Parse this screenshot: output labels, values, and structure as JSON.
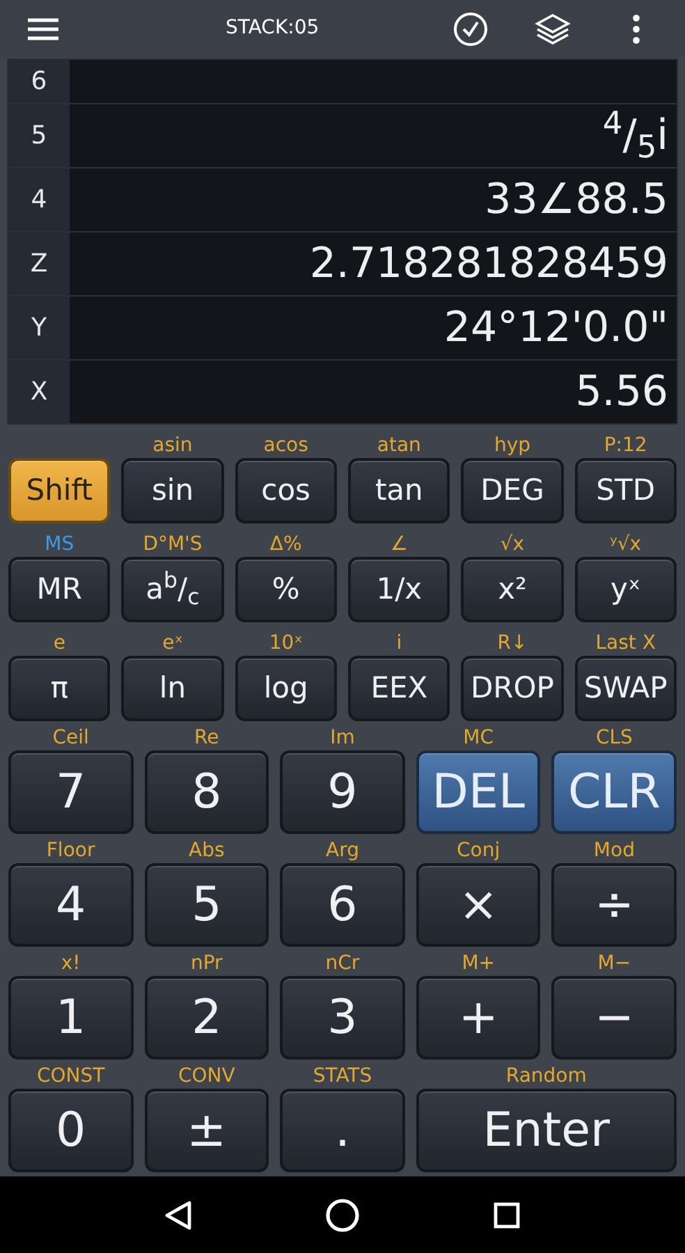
{
  "header": {
    "title": "STACK:05"
  },
  "stack": [
    {
      "label": "6"
    },
    {
      "label": "5",
      "value": "$^{4}$/$_{5}$i"
    },
    {
      "label": "4",
      "value": "33∠88.5"
    },
    {
      "label": "Z",
      "value": "2.718281828459"
    },
    {
      "label": "Y",
      "value": "24°12'0.0\""
    },
    {
      "label": "X",
      "value": "5.56"
    }
  ],
  "function_rows": [
    [
      {
        "label": "Shift",
        "kind": "shift"
      },
      {
        "label": "sin",
        "alt": {
          "text": "asin",
          "color": "#e3a82c"
        },
        "kind": "plain"
      },
      {
        "label": "cos",
        "alt": {
          "text": "acos",
          "color": "#e3a82c"
        },
        "kind": "plain"
      },
      {
        "label": "tan",
        "alt": {
          "text": "atan",
          "color": "#e3a82c"
        },
        "kind": "plain"
      },
      {
        "label": "DEG",
        "alt": {
          "text": "hyp",
          "color": "#e3a82c"
        },
        "kind": "plain"
      },
      {
        "label": "STD",
        "alt": {
          "text": "P:12",
          "color": "#e3a82c"
        },
        "kind": "plain"
      }
    ],
    [
      {
        "label": "MR",
        "alt": {
          "text": "MS",
          "color": "#3d9be3"
        },
        "kind": "plain"
      },
      {
        "label": "a$^{b}$/$_{c}$",
        "alt": {
          "text": "D°M'S",
          "color": "#e3a82c"
        },
        "kind": "plain"
      },
      {
        "label": "%",
        "alt": {
          "text": "Δ%",
          "color": "#e3a82c"
        },
        "kind": "plain"
      },
      {
        "label": "1/x",
        "alt": {
          "text": "∠",
          "color": "#e3a82c"
        },
        "kind": "plain"
      },
      {
        "label": "x²",
        "alt": {
          "text": "√x",
          "color": "#e3a82c"
        },
        "kind": "plain"
      },
      {
        "label": "yˣ",
        "alt": {
          "text": "ʸ√x",
          "color": "#e3a82c"
        },
        "kind": "plain"
      }
    ],
    [
      {
        "label": "π",
        "alt": {
          "text": "e",
          "color": "#e3a82c"
        },
        "kind": "plain"
      },
      {
        "label": "ln",
        "alt": {
          "text": "eˣ",
          "color": "#e3a82c"
        },
        "kind": "plain"
      },
      {
        "label": "log",
        "alt": {
          "text": "10ˣ",
          "color": "#e3a82c"
        },
        "kind": "plain"
      },
      {
        "label": "EEX",
        "alt": {
          "text": "i",
          "color": "#e3a82c"
        },
        "kind": "plain"
      },
      {
        "label": "DROP",
        "alt": {
          "text": "R↓",
          "color": "#e3a82c"
        },
        "kind": "plain"
      },
      {
        "label": "SWAP",
        "alt": {
          "text": "Last X",
          "color": "#e3a82c"
        },
        "kind": "plain"
      }
    ]
  ],
  "number_rows": [
    [
      {
        "label": "7",
        "alt": {
          "text": "Ceil",
          "color": "#e3a82c"
        },
        "kind": "plain"
      },
      {
        "label": "8",
        "alt": {
          "text": "Re",
          "color": "#e3a82c"
        },
        "kind": "plain"
      },
      {
        "label": "9",
        "alt": {
          "text": "Im",
          "color": "#e3a82c"
        },
        "kind": "plain"
      },
      {
        "label": "DEL",
        "alt": {
          "text": "MC",
          "color": "#e3a82c"
        },
        "kind": "accent"
      },
      {
        "label": "CLR",
        "alt": {
          "text": "CLS",
          "color": "#e3a82c"
        },
        "kind": "accent"
      }
    ],
    [
      {
        "label": "4",
        "alt": {
          "text": "Floor",
          "color": "#e3a82c"
        },
        "kind": "plain"
      },
      {
        "label": "5",
        "alt": {
          "text": "Abs",
          "color": "#e3a82c"
        },
        "kind": "plain"
      },
      {
        "label": "6",
        "alt": {
          "text": "Arg",
          "color": "#e3a82c"
        },
        "kind": "plain"
      },
      {
        "label": "×",
        "alt": {
          "text": "Conj",
          "color": "#e3a82c"
        },
        "kind": "plain"
      },
      {
        "label": "÷",
        "alt": {
          "text": "Mod",
          "color": "#e3a82c"
        },
        "kind": "plain"
      }
    ],
    [
      {
        "label": "1",
        "alt": {
          "text": "x!",
          "color": "#e3a82c"
        },
        "kind": "plain"
      },
      {
        "label": "2",
        "alt": {
          "text": "nPr",
          "color": "#e3a82c"
        },
        "kind": "plain"
      },
      {
        "label": "3",
        "alt": {
          "text": "nCr",
          "color": "#e3a82c"
        },
        "kind": "plain"
      },
      {
        "label": "+",
        "alt": {
          "text": "M+",
          "color": "#e3a82c"
        },
        "kind": "plain"
      },
      {
        "label": "−",
        "alt": {
          "text": "M−",
          "color": "#e3a82c"
        },
        "kind": "plain"
      }
    ],
    [
      {
        "label": "0",
        "alt": {
          "text": "CONST",
          "color": "#e3a82c"
        },
        "kind": "plain"
      },
      {
        "label": "±",
        "alt": {
          "text": "CONV",
          "color": "#e3a82c"
        },
        "kind": "plain"
      },
      {
        "label": ".",
        "alt": {
          "text": "STATS",
          "color": "#e3a82c"
        },
        "kind": "plain"
      },
      {
        "label": "Enter",
        "alt": {
          "text": "Random",
          "color": "#e3a82c"
        },
        "kind": "wide"
      }
    ]
  ]
}
